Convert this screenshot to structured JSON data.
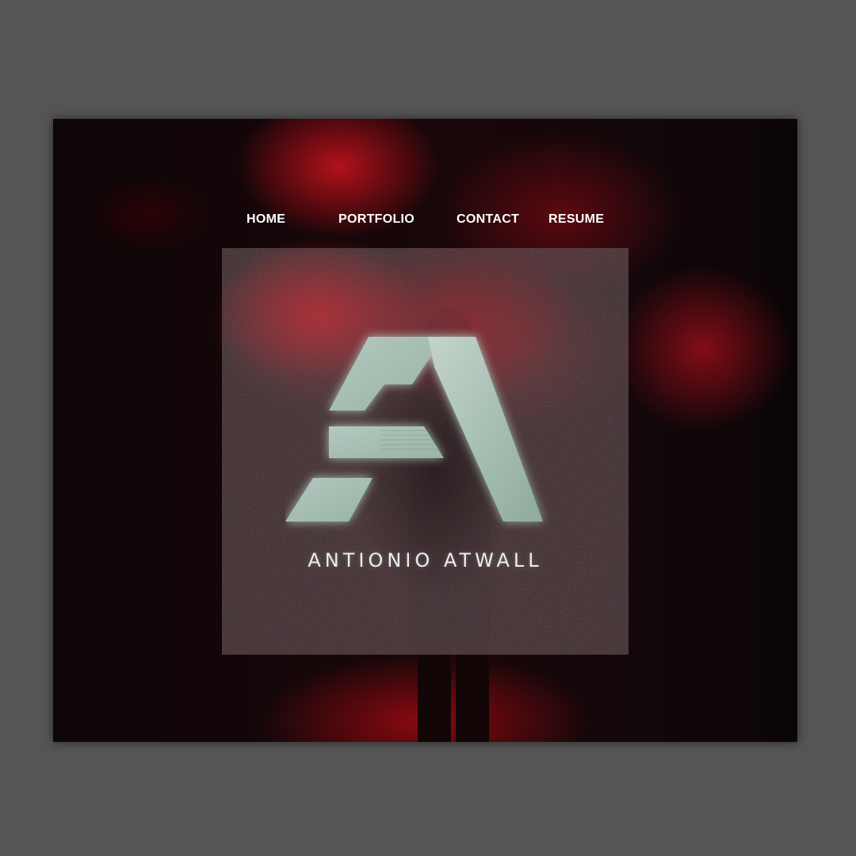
{
  "nav": {
    "items": [
      {
        "label": "HOME"
      },
      {
        "label": "PORTFOLIO"
      },
      {
        "label": "CONTACT"
      },
      {
        "label": "RESUME"
      }
    ]
  },
  "logo": {
    "brand_name": "ANTIONIO ATWALL",
    "mark_icon": "letter-a-logo-icon",
    "mark_color": "#a9c2b6"
  },
  "colors": {
    "page_bg": "#555555",
    "hero_dark": "#0f0708",
    "hero_red": "#c8141e",
    "nav_text": "#ffffff"
  }
}
